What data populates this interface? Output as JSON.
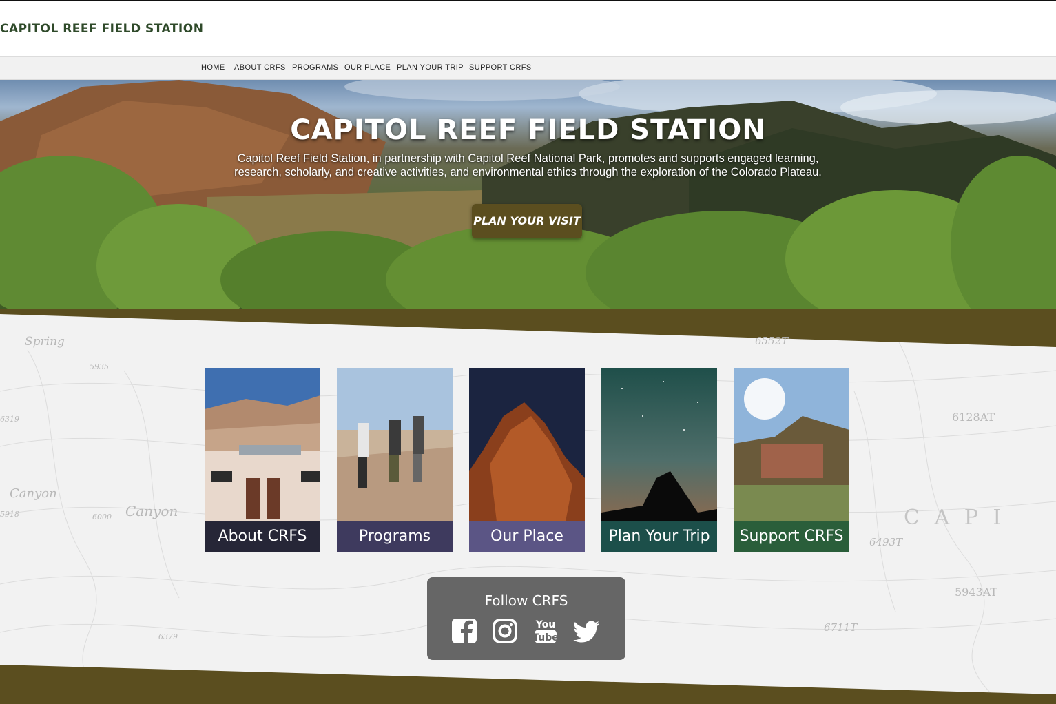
{
  "header": {
    "site_title": "CAPITOL REEF FIELD STATION"
  },
  "nav": {
    "items": [
      {
        "label": "HOME"
      },
      {
        "label": "ABOUT CRFS"
      },
      {
        "label": "PROGRAMS"
      },
      {
        "label": "OUR PLACE"
      },
      {
        "label": "PLAN YOUR TRIP"
      },
      {
        "label": "SUPPORT CRFS"
      }
    ]
  },
  "hero": {
    "title": "CAPITOL REEF FIELD STATION",
    "description": "Capitol Reef Field Station, in partnership with Capitol Reef National Park, promotes and supports engaged learning, research, scholarly, and creative activities, and environmental ethics through the exploration of the Colorado Plateau.",
    "button_label": "PLAN YOUR VISIT"
  },
  "cards": [
    {
      "label": "About CRFS",
      "color": "#262637"
    },
    {
      "label": "Programs",
      "color": "#3e3a5e"
    },
    {
      "label": "Our Place",
      "color": "#5b5585"
    },
    {
      "label": "Plan Your Trip",
      "color": "#1c4f4a"
    },
    {
      "label": "Support CRFS",
      "color": "#2a5e3a"
    }
  ],
  "map_labels": [
    "Spring",
    "Canyon",
    "Canyon",
    "C A P I",
    "6128AT",
    "5943AT",
    "6711T",
    "6493T",
    "5935",
    "6000",
    "6319",
    "5918",
    "6379",
    "6552T"
  ],
  "follow": {
    "title": "Follow CRFS",
    "icons": [
      "facebook-icon",
      "instagram-icon",
      "youtube-icon",
      "twitter-icon"
    ]
  },
  "colors": {
    "olive_band": "#5b4e1f",
    "title_green": "#2f4a2a"
  }
}
